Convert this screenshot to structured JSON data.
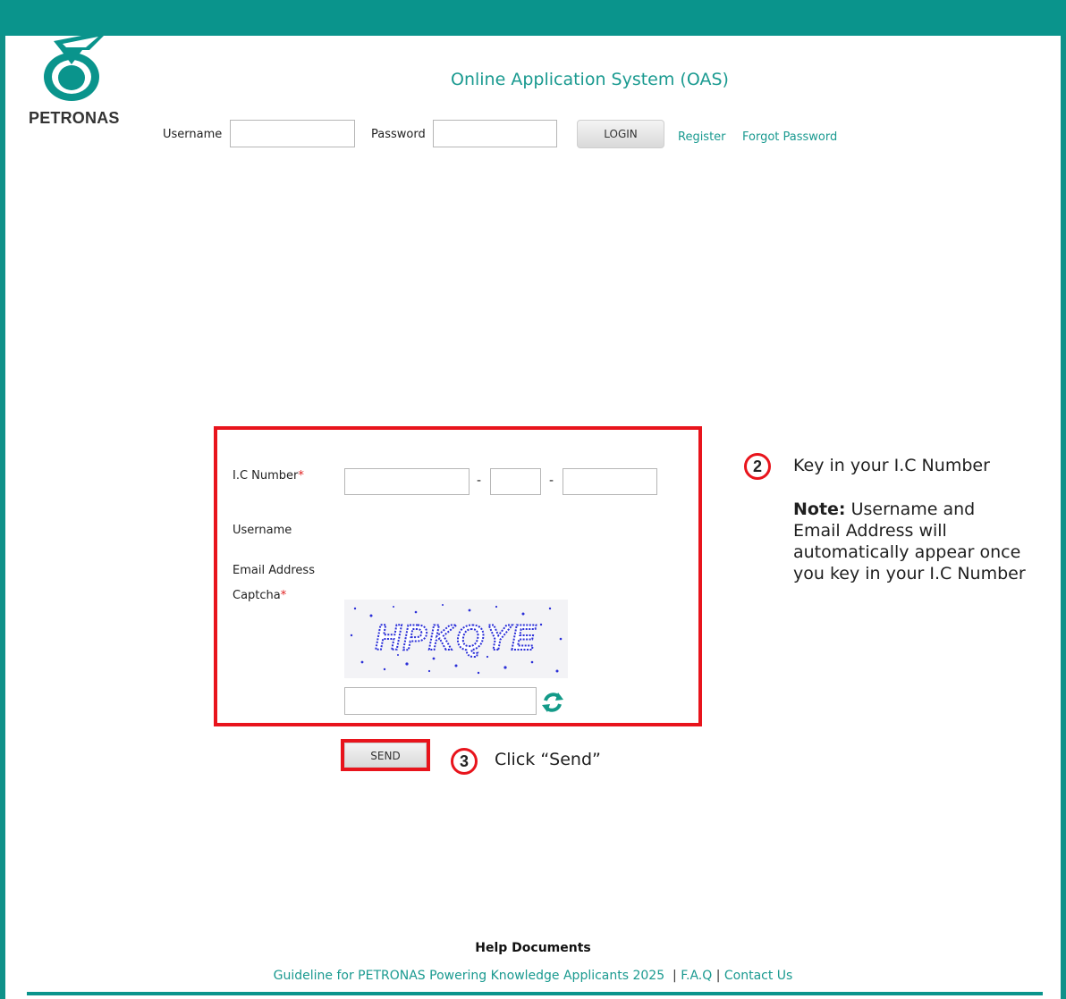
{
  "brand": {
    "logo_text": "PETRONAS",
    "accent_color": "#0a948c",
    "highlight_color": "#e8141c"
  },
  "header": {
    "title": "Online Application System (OAS)"
  },
  "login": {
    "username_label": "Username",
    "username_value": "",
    "password_label": "Password",
    "password_value": "",
    "login_button": "LOGIN",
    "register_link": "Register",
    "forgot_link": "Forgot Password"
  },
  "form": {
    "ic_label": "I.C Number",
    "required_mark": "*",
    "ic_part1": "",
    "ic_part2": "",
    "ic_part3": "",
    "ic_separator": "-",
    "username_label": "Username",
    "email_label": "Email Address",
    "captcha_label": "Captcha",
    "captcha_text": "HPKQYE",
    "captcha_input": "",
    "refresh_icon": "refresh-icon",
    "send_button": "SEND"
  },
  "annotations": {
    "step2_number": "2",
    "step2_text": "Key in your I.C Number",
    "note_label": "Note:",
    "note_text": "Username and Email Address will automatically appear once you key in your I.C Number",
    "step3_number": "3",
    "step3_text": "Click “Send”"
  },
  "footer": {
    "help_title": "Help Documents",
    "guideline_link": "Guideline for PETRONAS Powering Knowledge Applicants 2025",
    "faq_link": "F.A.Q",
    "contact_link": "Contact Us",
    "separator": "|"
  }
}
